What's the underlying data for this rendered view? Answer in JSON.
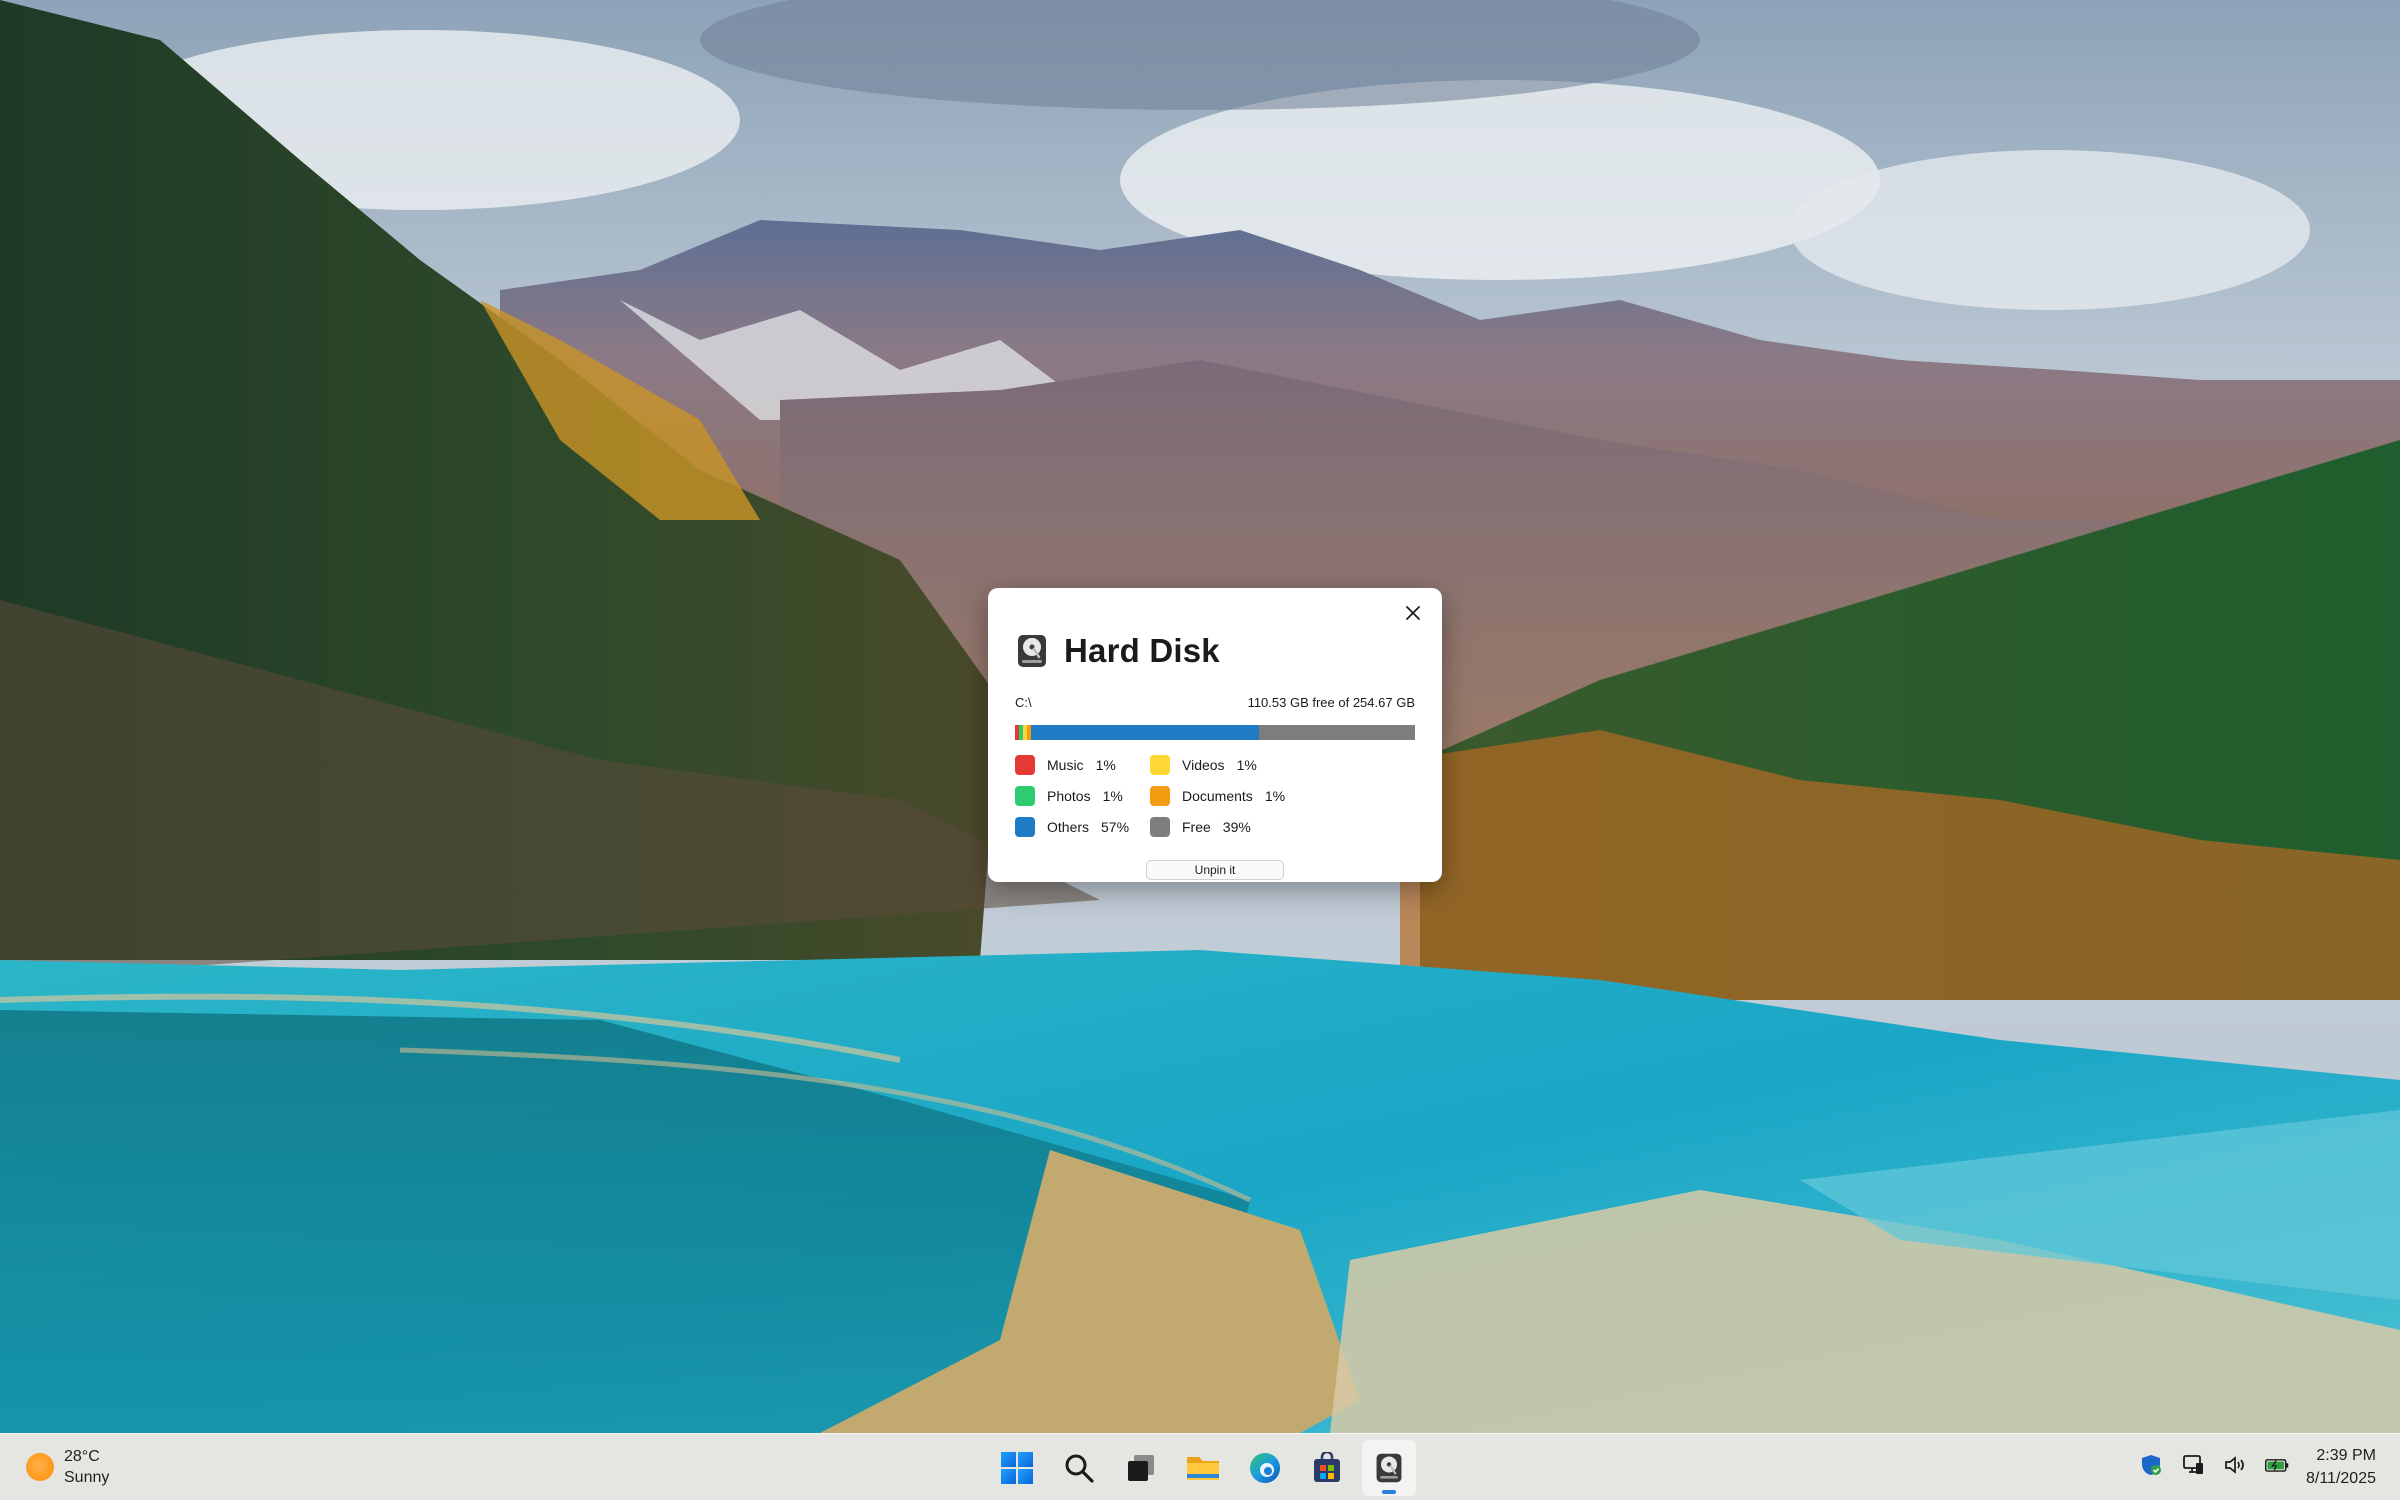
{
  "widget": {
    "title": "Hard Disk",
    "drive_label": "C:\\",
    "free_text": "110.53 GB free of 254.67 GB",
    "unpin_label": "Unpin it",
    "categories": [
      {
        "name": "Music",
        "percent": "1%",
        "value": 1,
        "color": "#e53935"
      },
      {
        "name": "Videos",
        "percent": "1%",
        "value": 1,
        "color": "#fdd835"
      },
      {
        "name": "Photos",
        "percent": "1%",
        "value": 1,
        "color": "#2ecc71"
      },
      {
        "name": "Documents",
        "percent": "1%",
        "value": 1,
        "color": "#f39c12"
      },
      {
        "name": "Others",
        "percent": "57%",
        "value": 57,
        "color": "#1e7bc4"
      },
      {
        "name": "Free",
        "percent": "39%",
        "value": 39,
        "color": "#7d7d7d"
      }
    ]
  },
  "taskbar": {
    "weather": {
      "temperature": "28°C",
      "condition": "Sunny"
    },
    "apps": [
      {
        "name": "start-button",
        "icon": "windows-logo-icon"
      },
      {
        "name": "search-button",
        "icon": "search-icon"
      },
      {
        "name": "task-view-button",
        "icon": "task-view-icon"
      },
      {
        "name": "file-explorer-button",
        "icon": "folder-icon"
      },
      {
        "name": "edge-button",
        "icon": "edge-icon"
      },
      {
        "name": "store-button",
        "icon": "store-icon"
      },
      {
        "name": "hard-disk-app-button",
        "icon": "hard-disk-icon",
        "active": true
      }
    ],
    "clock": {
      "time": "2:39 PM",
      "date": "8/11/2025"
    }
  }
}
